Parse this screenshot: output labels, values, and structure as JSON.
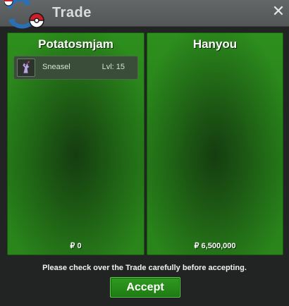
{
  "window": {
    "title": "Trade",
    "close_symbol": "✕"
  },
  "left_panel": {
    "player_name": "Potatosmjam",
    "items": [
      {
        "icon": "sneasel-icon",
        "name": "Sneasel",
        "level": "Lvl: 15"
      }
    ],
    "money": "₽ 0"
  },
  "right_panel": {
    "player_name": "Hanyou",
    "items": [],
    "money": "₽ 6,500,000"
  },
  "footer": {
    "notice": "Please check over the Trade carefully before accepting.",
    "accept_label": "Accept"
  },
  "colors": {
    "panel_green": "#2a861b",
    "accent_button": "#2f9a20",
    "title_bar": "#5c5f60",
    "logo_red": "#cc1f2a",
    "logo_blue": "#2b6fb5"
  }
}
